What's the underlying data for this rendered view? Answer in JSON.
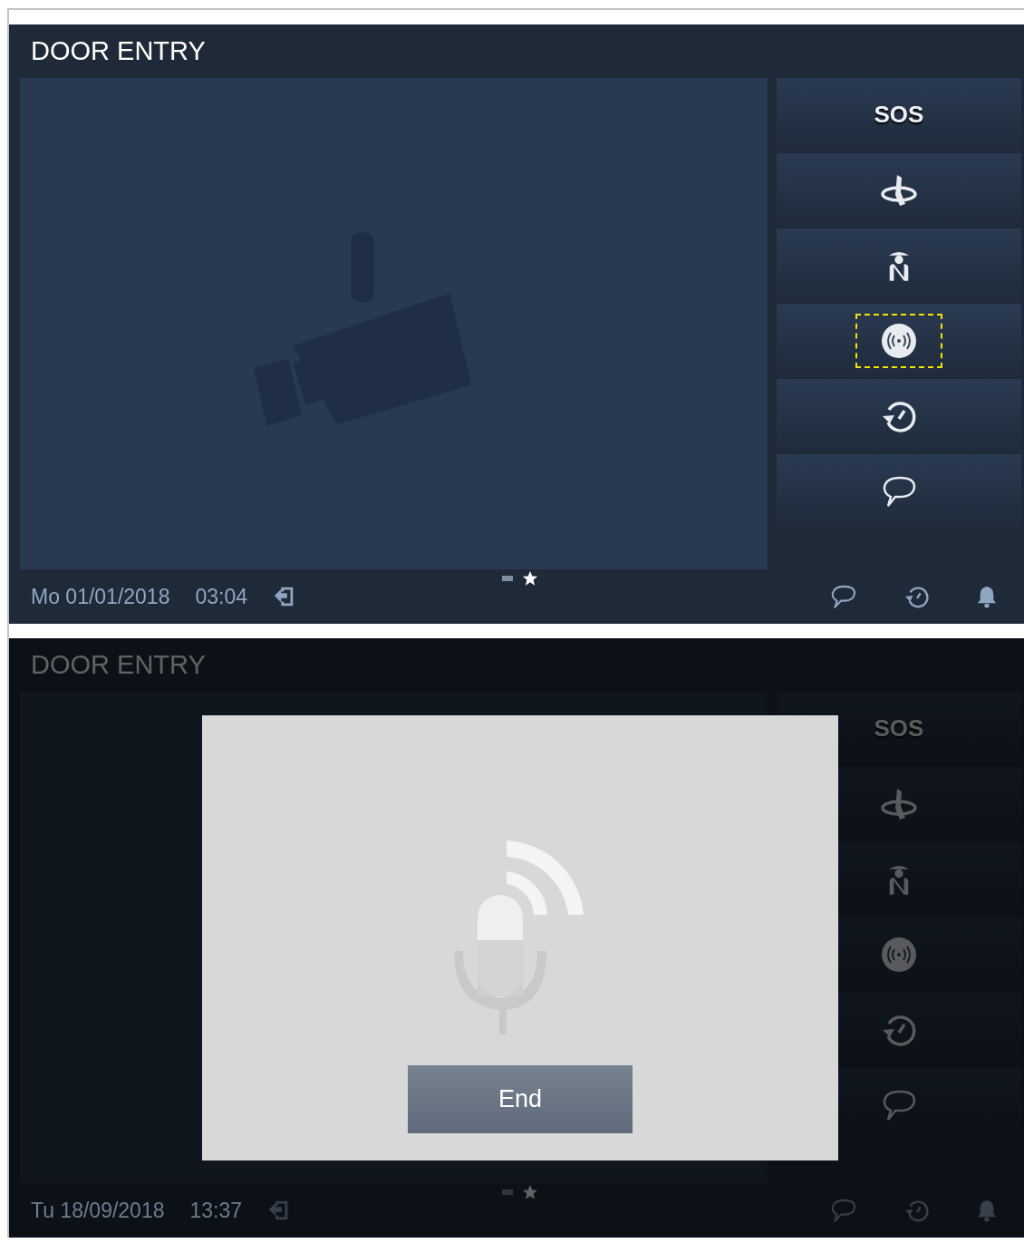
{
  "screens": [
    {
      "title": "DOOR ENTRY",
      "dimmed": false,
      "side_buttons": [
        {
          "kind": "text",
          "label": "SOS",
          "highlighted": false
        },
        {
          "kind": "ring",
          "highlighted": false
        },
        {
          "kind": "guard",
          "highlighted": false
        },
        {
          "kind": "signal",
          "highlighted": true
        },
        {
          "kind": "history",
          "highlighted": false
        },
        {
          "kind": "chat",
          "highlighted": false
        }
      ],
      "pages": [
        {
          "kind": "dash",
          "selected": false
        },
        {
          "kind": "star",
          "selected": true
        }
      ],
      "status": {
        "date": "Mo 01/01/2018",
        "time": "03:04"
      }
    },
    {
      "title": "DOOR ENTRY",
      "dimmed": true,
      "side_buttons": [
        {
          "kind": "text",
          "label": "SOS",
          "highlighted": false
        },
        {
          "kind": "ring",
          "highlighted": false
        },
        {
          "kind": "guard",
          "highlighted": false
        },
        {
          "kind": "signal",
          "highlighted": false
        },
        {
          "kind": "history",
          "highlighted": false
        },
        {
          "kind": "chat",
          "highlighted": false
        }
      ],
      "pages": [
        {
          "kind": "dash",
          "selected": false
        },
        {
          "kind": "star",
          "selected": true
        }
      ],
      "status": {
        "date": "Tu 18/09/2018",
        "time": "13:37"
      },
      "dialog": {
        "button": "End"
      }
    }
  ]
}
